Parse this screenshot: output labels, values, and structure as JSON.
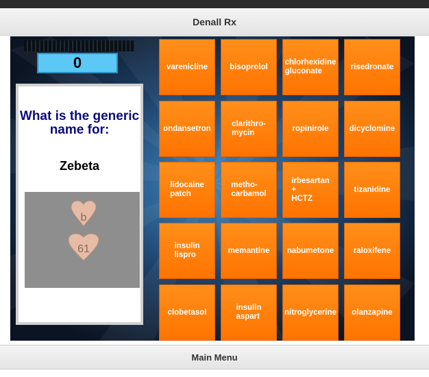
{
  "app": {
    "title": "Denall Rx"
  },
  "game": {
    "score": "0",
    "question": "What is the generic name for:",
    "brand_name": "Zebeta",
    "pill_imprints": [
      "b",
      "61"
    ],
    "tile_color": "#ff7d0a",
    "tiles": [
      "varenicline",
      "bisoprolol",
      "chlorhexidine\ngluconate",
      "risedronate",
      "ondansetron",
      "clarithro-\nmycin",
      "ropinirole",
      "dicyclomine",
      "lidocaine\npatch",
      "metho-\ncarbamol",
      "irbesartan\n+\nHCTZ",
      "tizanidine",
      "insulin\nlispro",
      "memantine",
      "nabumetone",
      "raloxifene",
      "clobetasol",
      "insulin\naspart",
      "nitroglycerine",
      "olanzapine"
    ]
  },
  "footer": {
    "main_menu_label": "Main Menu"
  }
}
